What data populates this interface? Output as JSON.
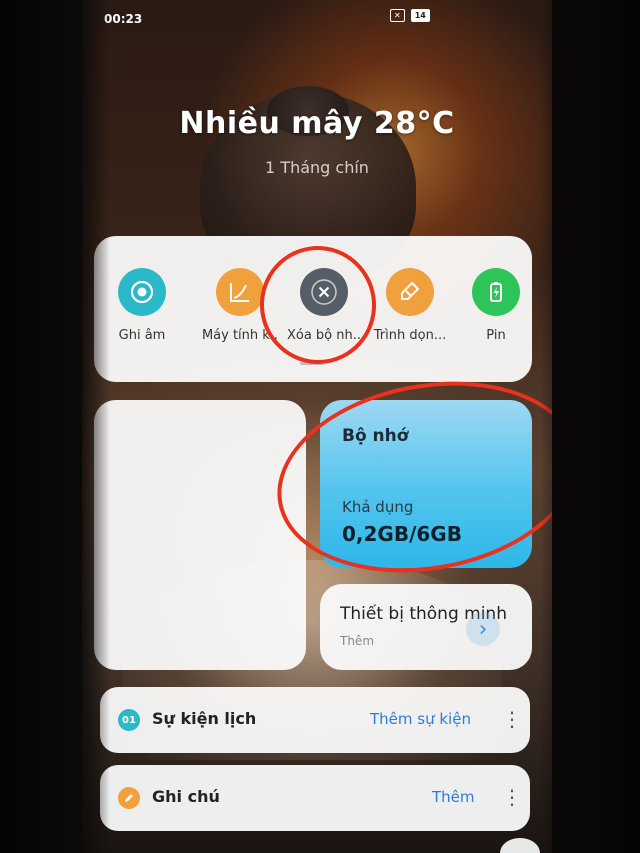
{
  "status_bar": {
    "time": "00:23",
    "indicator_box": "✕",
    "battery": "14"
  },
  "weather": {
    "condition_temp": "Nhiều mây 28°C",
    "date": "1 Tháng chín"
  },
  "quick_toggles": [
    {
      "label": "Ghi âm",
      "icon": "record-icon",
      "color": "#2bb8c9"
    },
    {
      "label": "Máy tính k..",
      "icon": "calculator-icon",
      "color": "#f0a13e"
    },
    {
      "label": "Xóa bộ nh..",
      "icon": "clear-memory-icon",
      "color": "#555e66"
    },
    {
      "label": "Trình dọn...",
      "icon": "cleaner-icon",
      "color": "#f0a13e"
    },
    {
      "label": "Pin",
      "icon": "battery-icon",
      "color": "#2dc45a"
    }
  ],
  "storage": {
    "title": "Bộ nhớ",
    "label": "Khả dụng",
    "value": "0,2GB/6GB"
  },
  "smart_devices": {
    "title": "Thiết bị thông minh",
    "subtitle": "Thêm",
    "arrow": "›"
  },
  "calendar_bar": {
    "icon_text": "01",
    "title": "Sự kiện lịch",
    "action": "Thêm sự kiện",
    "menu": "⋮"
  },
  "notes_bar": {
    "title": "Ghi chú",
    "action": "Thêm",
    "menu": "⋮"
  },
  "colors": {
    "annotation_red": "#e8321e",
    "storage_blue": "#2eb7e8",
    "link_blue": "#2a7ed9"
  }
}
